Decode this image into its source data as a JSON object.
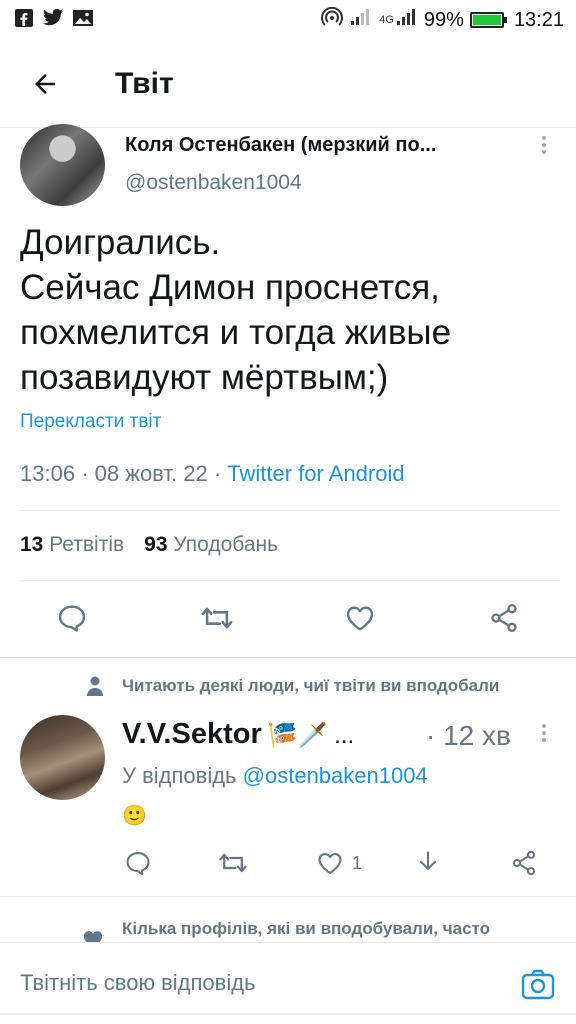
{
  "status_bar": {
    "network": "4G",
    "battery_percent": "99%",
    "battery_level": 0.99,
    "time": "13:21",
    "icons": [
      "facebook-icon",
      "twitter-icon",
      "gallery-icon",
      "hotspot-icon",
      "signal-icon",
      "signal-4g-icon",
      "battery-icon"
    ]
  },
  "header": {
    "back_icon": "arrow-left-icon",
    "title": "Твіт"
  },
  "tweet": {
    "author_name": "Коля Остенбакен (мерзкий по...",
    "author_handle": "@ostenbaken1004",
    "text": "Доигрались.\nСейчас Димон проснется, похмелится и тогда живые позавидуют мёртвым;)",
    "translate_label": "Перекласти твіт",
    "time": "13:06",
    "date": "08 жовт. 22",
    "separator": "·",
    "source": "Twitter for Android",
    "retweets_count": "13",
    "retweets_label": "Ретвітів",
    "likes_count": "93",
    "likes_label": "Уподобань",
    "actions": [
      "reply-icon",
      "retweet-icon",
      "like-icon",
      "share-icon"
    ]
  },
  "reply": {
    "context_icon": "person-icon",
    "context_text": "Читають деякі люди, чиї твіти ви вподобали",
    "name": "V.V.Sektor",
    "name_suffix": "🎏🗡️ ...",
    "time": "· 12 хв",
    "in_reply_to_label": "У відповідь",
    "in_reply_to_handle": "@ostenbaken1004",
    "text": "🙂",
    "like_count": "1",
    "actions": [
      "reply-icon",
      "retweet-icon",
      "like-icon",
      "download-icon",
      "share-icon"
    ]
  },
  "next_item": {
    "context_icon": "heart-icon",
    "context_text": "Кілька профілів, які ви вподобували, часто"
  },
  "composer": {
    "placeholder": "Твітніть свою відповідь",
    "camera_icon": "camera-icon"
  },
  "colors": {
    "accent": "#1b95e0",
    "text": "#14171a",
    "secondary": "#657786",
    "divider": "#e6ecf0",
    "battery": "#23c93b"
  }
}
